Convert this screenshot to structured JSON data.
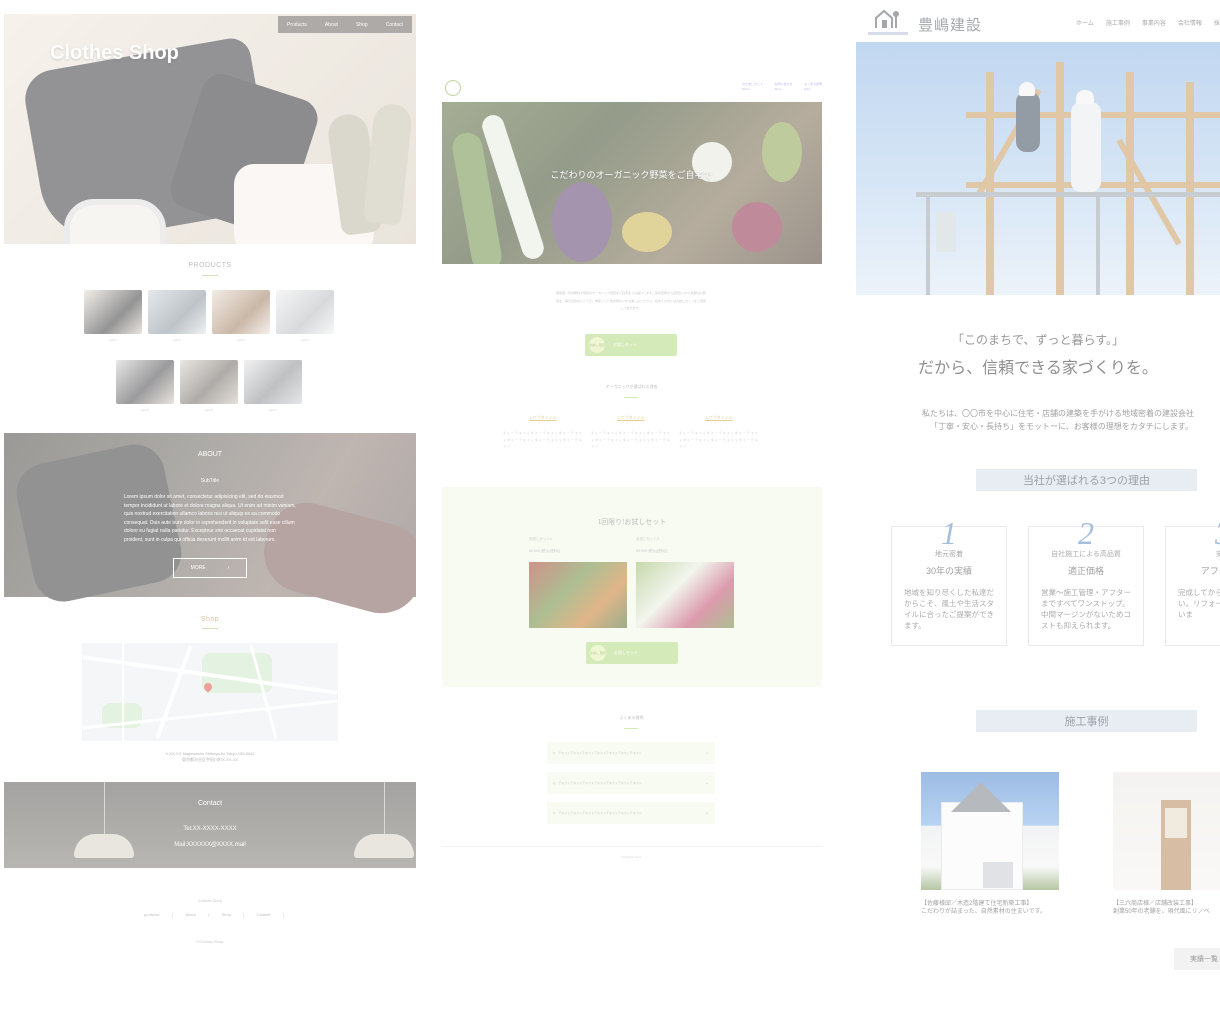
{
  "panel1": {
    "hero_title": "Clothes Shop",
    "nav": [
      "Products",
      "About",
      "Shop",
      "Contact"
    ],
    "products_heading": "PRODUCTS",
    "product_items": [
      "Item1",
      "item2",
      "item3",
      "item4",
      "item5",
      "item6",
      "item7"
    ],
    "about": {
      "heading": "ABOUT",
      "subtitle": "SubTitle",
      "body": "Lorem ipsum dolor sit amet, consectetur adipisicing elit, sed do eiusmod tempor incididunt ut labore et dolore magna aliqua. Ut enim ad minim veniam, quis nostrud exercitation ullamco laboris nisi ut aliquip ex ea commodo consequat. Duis aute irure dolor in reprehenderit in voluptate velit esse cillum dolore eu fugiat nulla pariatur. Excepteur sint occaecat cupidatat non proident, sunt in culpa qui officia deserunt mollit anim id est laborum.",
      "more_label": "MORE"
    },
    "shop_heading": "Shop",
    "address_line1": "X-XX-XX Magewacho Shibuya-ku Tokyo 150-0042",
    "address_line2": "東京都渋谷区宇田川町X-XX-XX",
    "contact": {
      "heading": "Contact",
      "tel": "Tel:XX-XXXX-XXXX",
      "mail": "Mail:XXXXXX@XXXX.mail"
    },
    "footer_brand": "Clothes Shop",
    "footer_nav": [
      "products",
      "About",
      "Shop",
      "Contact"
    ],
    "footer_copy": "©Clothes Shop"
  },
  "panel2": {
    "nav": [
      {
        "jp": "おためしセット",
        "en": "Show"
      },
      {
        "jp": "お問い合わせ",
        "en": "Shop"
      },
      {
        "jp": "よくある質問",
        "en": "Q&A"
      }
    ],
    "hero_title": "こだわりのオーガニック野菜をご自宅で",
    "intro_text": "無農薬・化学肥料不使用のオーガニック野菜をご自宅までお届けします。契約農家から直接仕入れた新鮮なお野菜を、毎日の食卓にどうぞ。季節ごとに旬の味わいをお楽しみください。初めての方にはお試しセットをご用意しております。",
    "cta_badge": "お試し\n限定",
    "cta_label": "お試しセット",
    "reasons_heading": "オーガニックが選ばれる理由",
    "sub_titles": [
      "1.サブタイトル",
      "2.サブタイトル",
      "3.サブタイトル"
    ],
    "dummy_text": "ダミーテキストダミーテキストダミーテキストダミーテキストダミーテキストダミーテキスト",
    "trial": {
      "heading": "1回限り!お試しセット",
      "sets": [
        {
          "name": "お試しセット1",
          "price": "¥2,000 (税込)送料込"
        },
        {
          "name": "お試しセット2",
          "price": "¥3,000 (税込)送料込"
        }
      ]
    },
    "faq_heading": "よくある質問",
    "faq_items": [
      "テキストテキストテキストテキストテキストテキストテキスト",
      "テキストテキストテキストテキストテキストテキストテキスト",
      "テキストテキストテキストテキストテキストテキストテキスト"
    ],
    "footer_copy": "©Organic Shop"
  },
  "panel3": {
    "logo": "豊嶋建設",
    "nav": [
      "ホーム",
      "施工事例",
      "事業内容",
      "会社情報",
      "採用"
    ],
    "quote1": "「このまちで、ずっと暮らす。」",
    "quote2": "だから、信頼できる家づくりを。",
    "lead_line1": "私たちは、〇〇市を中心に住宅・店舗の建築を手がける地域密着の建設会社",
    "lead_line2": "「丁寧・安心・長持ち」をモットーに、お客様の理想をカタチにします。",
    "reasons_heading": "当社が選ばれる3つの理由",
    "reasons": [
      {
        "num": "1",
        "sub": "地元密着",
        "title": "30年の実績",
        "text": "地域を知り尽くした私達だからこそ、風土や生活スタイルに合ったご提案ができます。"
      },
      {
        "num": "2",
        "sub": "自社施工による高品質",
        "title": "適正価格",
        "text": "営業〜施工管理・アフターまですべてワンストップ。中間マージンがないためコストも抑えられます。"
      },
      {
        "num": "3",
        "sub": "安心",
        "title": "アフターフ",
        "text": "完成してからもお付き合い。リフォームなど寄り添いま"
      }
    ],
    "cases_heading": "施工事例",
    "cases": [
      {
        "line1": "【佐藤様邸／木造2階建て住宅新築工事】",
        "line2": "こだわりが詰まった、自然素材の住まいです。"
      },
      {
        "line1": "【三六商店様／店舗改装工事】",
        "line2": "創業50年の老舗を、現代風にリノベ"
      }
    ],
    "more_label": "実績一覧"
  }
}
